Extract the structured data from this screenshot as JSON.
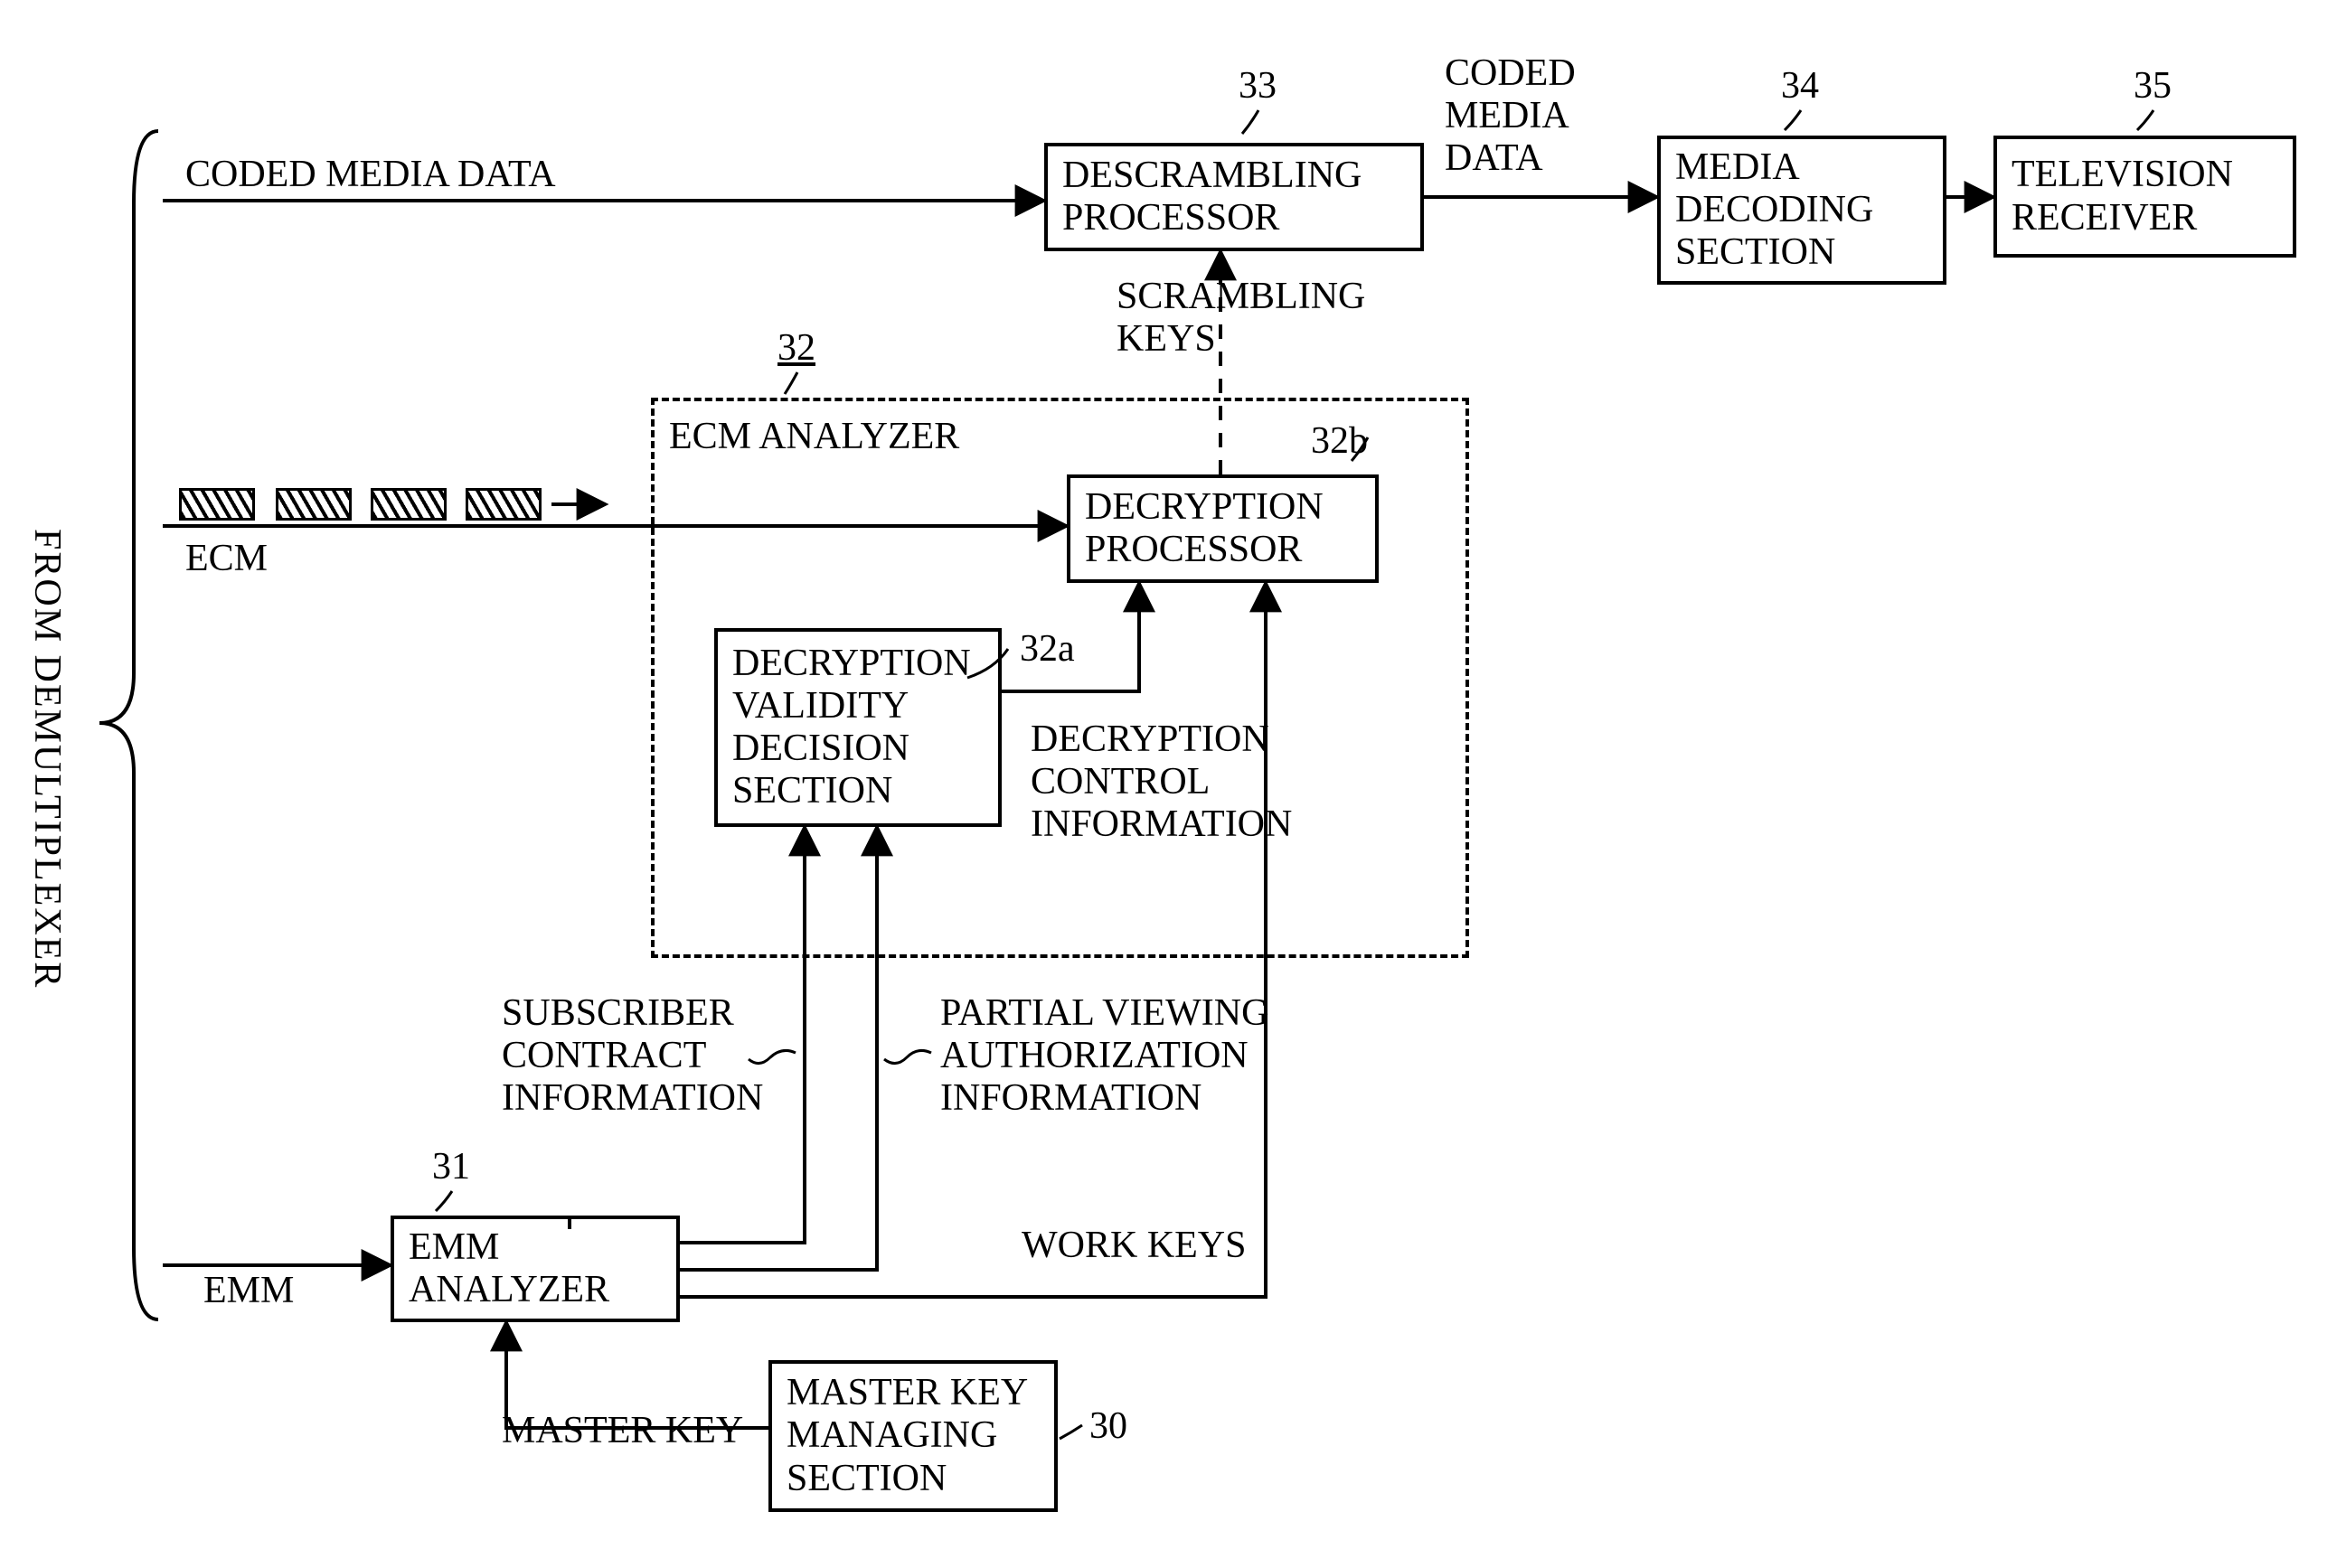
{
  "source_label": "FROM DEMULTIPLEXER",
  "inputs": {
    "coded_media_data": "CODED MEDIA DATA",
    "ecm": "ECM",
    "emm": "EMM"
  },
  "blocks": {
    "descrambling_processor": {
      "ref": "33",
      "label": "DESCRAMBLING\nPROCESSOR"
    },
    "media_decoding_section": {
      "ref": "34",
      "label": "MEDIA\nDECODING\nSECTION"
    },
    "television_receiver": {
      "ref": "35",
      "label": "TELEVISION\nRECEIVER"
    },
    "ecm_analyzer": {
      "ref": "32",
      "label": "ECM ANALYZER"
    },
    "decryption_processor": {
      "ref": "32b",
      "label": "DECRYPTION\nPROCESSOR"
    },
    "decryption_validity": {
      "ref": "32a",
      "label": "DECRYPTION\nVALIDITY\nDECISION\nSECTION"
    },
    "emm_analyzer": {
      "ref": "31",
      "label": "EMM\nANALYZER"
    },
    "master_key_managing": {
      "ref": "30",
      "label": "MASTER KEY\nMANAGING\nSECTION"
    }
  },
  "signals": {
    "coded_media_data_out": "CODED\nMEDIA\nDATA",
    "scrambling_keys": "SCRAMBLING\nKEYS",
    "decryption_control_info": "DECRYPTION\nCONTROL\nINFORMATION",
    "subscriber_contract_info": "SUBSCRIBER\nCONTRACT\nINFORMATION",
    "partial_viewing_auth_info": "PARTIAL VIEWING\nAUTHORIZATION\nINFORMATION",
    "work_keys": "WORK KEYS",
    "master_key": "MASTER KEY"
  }
}
